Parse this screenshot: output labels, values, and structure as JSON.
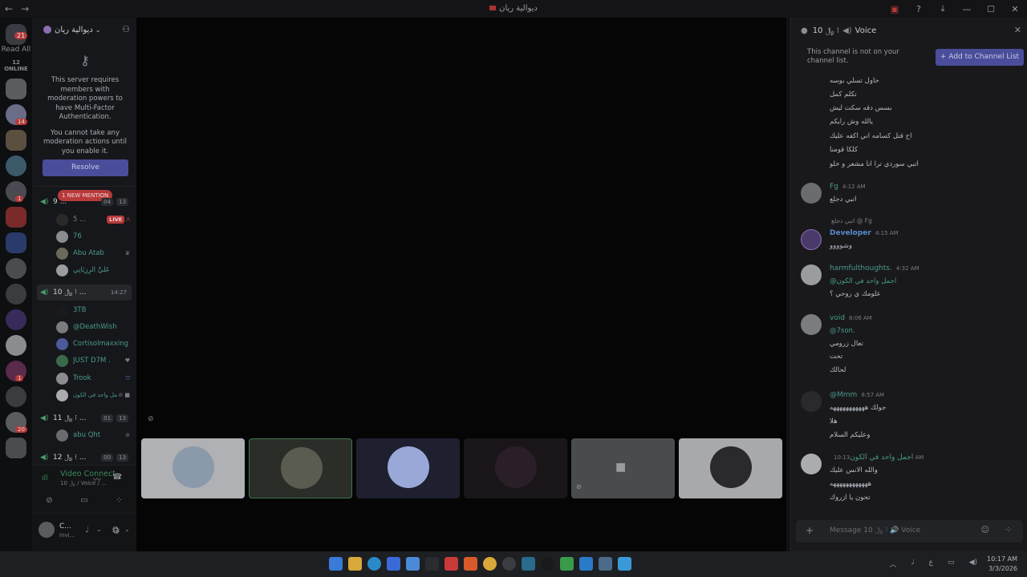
{
  "window": {
    "title": "ديوالية ريان",
    "nav_back": "←",
    "nav_forward": "→"
  },
  "rail": {
    "home_badge": "21",
    "read_all": "Read All",
    "online": "12 ONLINE",
    "server_badges": [
      "14",
      "1",
      "1",
      "20"
    ]
  },
  "server": {
    "name": "ديوالية ريان",
    "mfa_notice": "This server requires members with moderation powers to have Multi-Factor Authentication.",
    "mfa_notice_2": "You cannot take any moderation actions until you enable it.",
    "resolve_label": "Resolve",
    "new_mention": "1 NEW MENTION"
  },
  "channels": {
    "c1": {
      "name": "9 ... ",
      "count_a": "04",
      "count_b": "13"
    },
    "c2": {
      "name": "10 ﷼ ⁝ ...",
      "time": "14:27"
    },
    "c3": {
      "name": "11 ﷼ ⁝ ...",
      "count_a": "01",
      "count_b": "13"
    },
    "c4": {
      "name": "12 ﷼ ⁝ ...",
      "count_a": "00",
      "count_b": "13"
    }
  },
  "members": {
    "live_user": "5 ...",
    "live_label": "LIVE",
    "m76": "76",
    "abu_atab": "Abu Atab",
    "m_arabic1": "عَلَيَّ الْرِزِيَانِي",
    "m_3tb": "3TB",
    "deathwish": "@DeathWish",
    "cortisol": "Cortisolmaxxing",
    "just": "JUST D7M .",
    "trook": "Trook",
    "m_arabic2": "أجمل واحد في الكون",
    "abu_qht": "abu Qht"
  },
  "voice_panel": {
    "title": "Video Connected",
    "subtitle": "10 ﷼ / Voice / ..."
  },
  "user": {
    "name": "C...",
    "status": "Invi..."
  },
  "chat": {
    "header_name": "10 ﷼ ⁝",
    "header_channel": "Voice",
    "notice": "This channel is not on your channel list.",
    "add_button": "Add to Channel List",
    "composer_placeholder": "Message 10 ﷼ ⁝ 🔊 Voice",
    "top_lines": [
      "حاول تسلي بوسه",
      "تكلم كمل",
      "بسس دقه سكت ليش",
      "يالله وش رايكم",
      "اح قتل كسامه اني اكفه عليك",
      "كلكا قومنا",
      "اتبي سوردي ترا انا مشعر و خلو"
    ],
    "msg_fg": {
      "author": "Fg",
      "time": "4:12 AM",
      "text": "اتبي دجلع"
    },
    "msg_dev": {
      "reply": "اتبي دجلع @ Fg",
      "author": "Developer",
      "time": "4:15 AM",
      "text": "وشوووو"
    },
    "msg_harm": {
      "author": "harmfulthoughts.",
      "time": "4:32 AM",
      "mention": "@اجمل واحد في الكون",
      "text": "علومك ي روحي ؟"
    },
    "msg_void": {
      "author": "void",
      "time": "8:06 AM",
      "mention": "@7son.",
      "l1": "تعال زرومي",
      "l2": "تحت",
      "l3": "لحالك"
    },
    "msg_mmm": {
      "author": "@Mmm",
      "time": "8:57 AM",
      "l1": "جولك هههههههههههه",
      "l2": "هلا",
      "l3": "وعليكم السلام"
    },
    "msg_last": {
      "author": "اجمل واحد في الكون",
      "time": "10:13 AM",
      "l1": "والله الانس عليك",
      "l2": "ههههههههههههه",
      "l3": "تحون يا ازروك"
    }
  },
  "taskbar": {
    "time": "10:17 AM",
    "date": "3/3/2026",
    "lang": "ع"
  }
}
